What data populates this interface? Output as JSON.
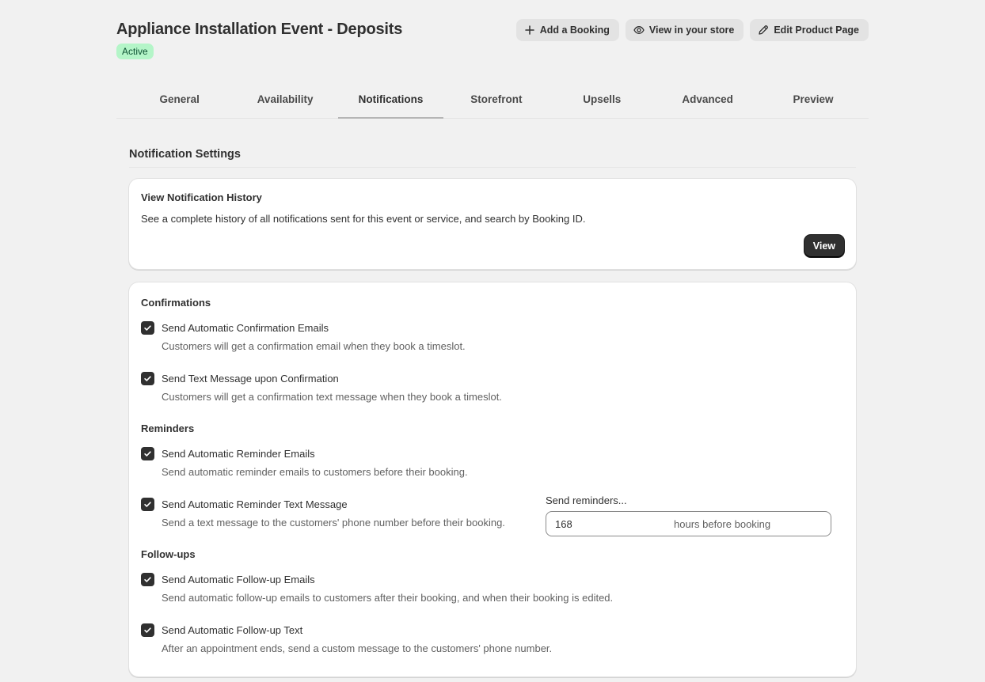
{
  "header": {
    "title": "Appliance Installation Event - Deposits",
    "status_badge": "Active",
    "actions": [
      {
        "label": "Add a Booking",
        "icon": "plus-icon"
      },
      {
        "label": "View in your store",
        "icon": "eye-icon"
      },
      {
        "label": "Edit Product Page",
        "icon": "pencil-icon"
      }
    ]
  },
  "tabs": [
    {
      "label": "General",
      "active": false
    },
    {
      "label": "Availability",
      "active": false
    },
    {
      "label": "Notifications",
      "active": true
    },
    {
      "label": "Storefront",
      "active": false
    },
    {
      "label": "Upsells",
      "active": false
    },
    {
      "label": "Advanced",
      "active": false
    },
    {
      "label": "Preview",
      "active": false
    }
  ],
  "notifications": {
    "section_title": "Notification Settings",
    "history_card": {
      "heading": "View Notification History",
      "description": "See a complete history of all notifications sent for this event or service, and search by Booking ID.",
      "button_label": "View"
    },
    "groups": {
      "confirmations": {
        "heading": "Confirmations",
        "options": [
          {
            "label": "Send Automatic Confirmation Emails",
            "help": "Customers will get a confirmation email when they book a timeslot.",
            "checked": true
          },
          {
            "label": "Send Text Message upon Confirmation",
            "help": "Customers will get a confirmation text message when they book a timeslot.",
            "checked": true
          }
        ]
      },
      "reminders": {
        "heading": "Reminders",
        "options": [
          {
            "label": "Send Automatic Reminder Emails",
            "help": "Send automatic reminder emails to customers before their booking.",
            "checked": true
          },
          {
            "label": "Send Automatic Reminder Text Message",
            "help": "Send a text message to the customers' phone number before their booking.",
            "checked": true
          }
        ],
        "reminder_field": {
          "label": "Send reminders...",
          "value": "168",
          "suffix": "hours before booking"
        }
      },
      "followups": {
        "heading": "Follow-ups",
        "options": [
          {
            "label": "Send Automatic Follow-up Emails",
            "help": "Send automatic follow-up emails to customers after their booking, and when their booking is edited.",
            "checked": true
          },
          {
            "label": "Send Automatic Follow-up Text",
            "help": "After an appointment ends, send a custom message to the customers' phone number.",
            "checked": true
          }
        ]
      }
    }
  },
  "colors": {
    "background": "#f1f1f1",
    "badge_bg": "#b4f5c8",
    "badge_text": "#0c5132",
    "primary_button": "#303030",
    "checkbox": "#303030"
  }
}
